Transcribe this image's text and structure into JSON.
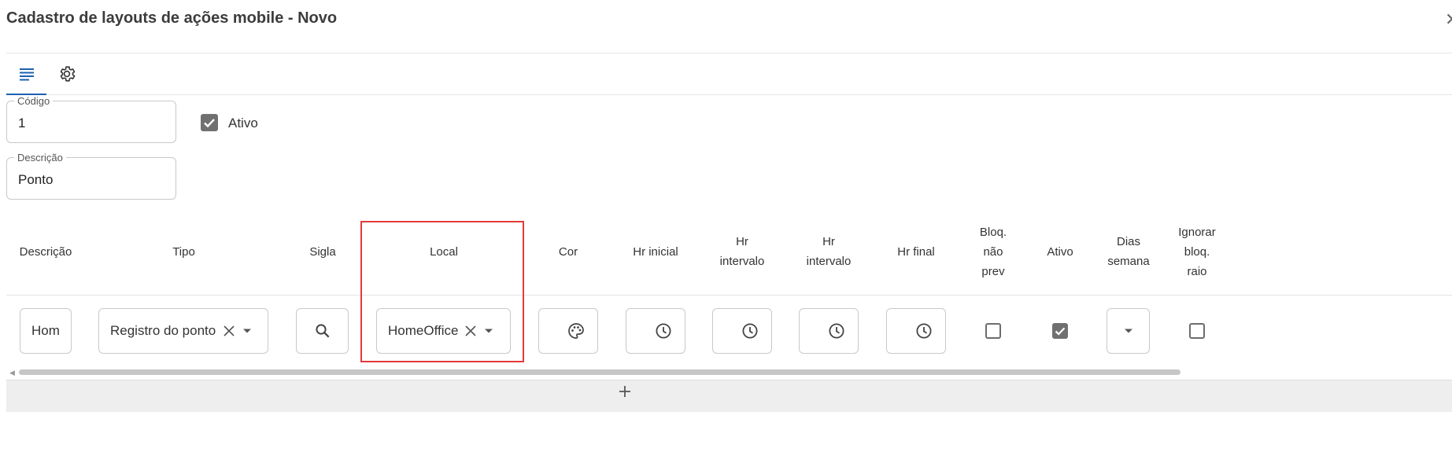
{
  "dialog": {
    "title": "Cadastro de layouts de ações mobile - Novo"
  },
  "tabs": [
    {
      "name": "tab-list",
      "icon": "list-icon",
      "active": true
    },
    {
      "name": "tab-settings",
      "icon": "gear-icon",
      "active": false
    }
  ],
  "form": {
    "codigo": {
      "label": "Código",
      "value": "1"
    },
    "ativo": {
      "label": "Ativo",
      "checked": true
    },
    "descricao": {
      "label": "Descrição",
      "value": "Ponto"
    }
  },
  "grid": {
    "headers": {
      "descricao": "Descrição",
      "tipo": "Tipo",
      "sigla": "Sigla",
      "local": "Local",
      "cor": "Cor",
      "hr_inicial": "Hr inicial",
      "hr_intervalo_1": [
        "Hr",
        "intervalo"
      ],
      "hr_intervalo_2": [
        "Hr",
        "intervalo"
      ],
      "hr_final": "Hr final",
      "bloq_nao_prev": [
        "Bloq.",
        "não",
        "prev"
      ],
      "ativo": "Ativo",
      "dias_semana": [
        "Dias",
        "semana"
      ],
      "ignorar_bloq_raio": [
        "Ignorar",
        "bloq.",
        "raio"
      ]
    },
    "row": {
      "descricao": "Hom",
      "tipo": "Registro do ponto",
      "local": "HomeOffice",
      "bloq_nao_prev": false,
      "ativo": true,
      "ignorar_bloq_raio": false
    }
  },
  "colors": {
    "accent": "#1d5fb0",
    "highlight": "#e23b3b",
    "checkbox": "#707070"
  }
}
